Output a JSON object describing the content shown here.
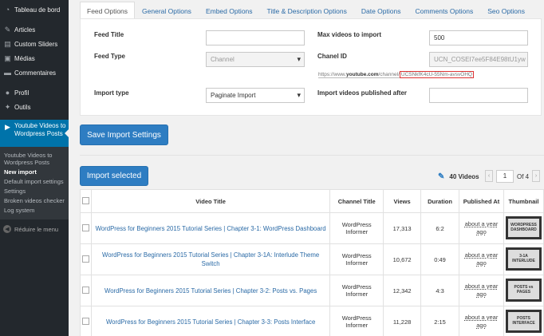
{
  "sidebar": {
    "items": [
      {
        "label": "Tableau de bord",
        "icon": "dashboard-icon"
      },
      {
        "label": "Articles",
        "icon": "pin-icon"
      },
      {
        "label": "Custom Sliders",
        "icon": "sliders-icon"
      },
      {
        "label": "Médias",
        "icon": "media-icon"
      },
      {
        "label": "Commentaires",
        "icon": "comments-icon"
      },
      {
        "label": "Profil",
        "icon": "user-icon"
      },
      {
        "label": "Outils",
        "icon": "wrench-icon"
      }
    ],
    "active": {
      "label": "Youtube Videos to Wordpress Posts",
      "icon": "video-icon"
    },
    "submenu": [
      "Youtube Videos to Wordpress Posts",
      "New import",
      "Default import settings",
      "Settings",
      "Broken videos checker",
      "Log system"
    ],
    "collapse": "Réduire le menu"
  },
  "tabs": [
    "Feed Options",
    "General Options",
    "Embed Options",
    "Title & Description Options",
    "Date Options",
    "Comments Options",
    "Seo Options"
  ],
  "form": {
    "feed_title_label": "Feed Title",
    "feed_title_value": "",
    "feed_type_label": "Feed Type",
    "feed_type_value": "Channel",
    "import_type_label": "Import type",
    "import_type_value": "Paginate Import",
    "max_videos_label": "Max videos to import",
    "max_videos_value": "500",
    "channel_id_label": "Chanel ID",
    "channel_id_value": "UCN_COSEI7ee5F84E98tU1yw",
    "hint_prefix": "https://www.",
    "hint_bold": "youtube.com",
    "hint_mid": "/channel/",
    "hint_highlight": "UCSNkfK4cU-55Nm-avsvOHQ",
    "after_label": "Import videos published after",
    "after_value": ""
  },
  "save_button": "Save Import Settings",
  "import_button": "Import selected",
  "video_count": "40 Videos",
  "pager": {
    "prev": "‹",
    "page": "1",
    "of": "Of 4",
    "next": "›"
  },
  "table": {
    "headers": [
      "Video Title",
      "Channel Title",
      "Views",
      "Duration",
      "Published At",
      "Thumbnail"
    ],
    "rows": [
      {
        "title": "WordPress for Beginners 2015 Tutorial Series | Chapter 3-1: WordPress Dashboard",
        "channel": "WordPress Informer",
        "views": "17,313",
        "duration": "6:2",
        "published": "about a year ago",
        "thumb": "WORDPRESS DASHBOARD"
      },
      {
        "title": "WordPress for Beginners 2015 Tutorial Series | Chapter 3-1A: Interlude Theme Switch",
        "channel": "WordPress Informer",
        "views": "10,672",
        "duration": "0:49",
        "published": "about a year ago",
        "thumb": "3-1A INTERLUDE"
      },
      {
        "title": "WordPress for Beginners 2015 Tutorial Series | Chapter 3-2: Posts vs. Pages",
        "channel": "WordPress Informer",
        "views": "12,342",
        "duration": "4:3",
        "published": "about a year ago",
        "thumb": "POSTS vs PAGES"
      },
      {
        "title": "WordPress for Beginners 2015 Tutorial Series | Chapter 3-3: Posts Interface",
        "channel": "WordPress Informer",
        "views": "11,228",
        "duration": "2:15",
        "published": "about a year ago",
        "thumb": "POSTS INTERFACE"
      }
    ]
  }
}
